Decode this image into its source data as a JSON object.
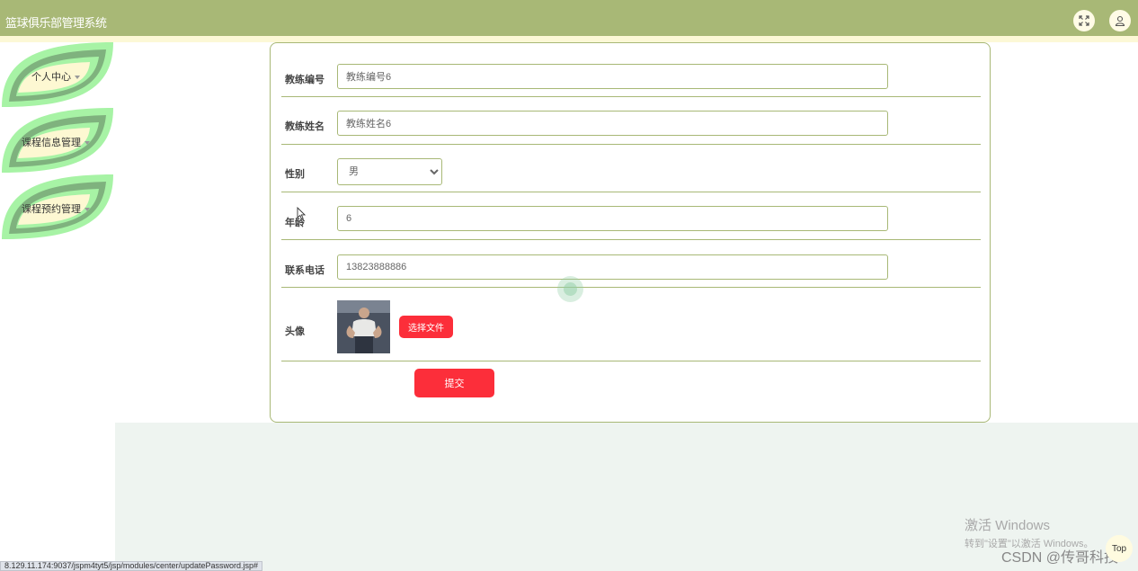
{
  "header": {
    "title": "篮球俱乐部管理系统",
    "fullscreen_icon": "fullscreen-icon",
    "user_icon": "user-icon"
  },
  "sidebar": {
    "items": [
      {
        "label": "个人中心"
      },
      {
        "label": "课程信息管理"
      },
      {
        "label": "课程预约管理"
      }
    ]
  },
  "form": {
    "fields": {
      "coach_id": {
        "label": "教练编号",
        "value": "教练编号6"
      },
      "coach_name": {
        "label": "教练姓名",
        "value": "教练姓名6"
      },
      "gender": {
        "label": "性别",
        "value": "男"
      },
      "age": {
        "label": "年龄",
        "value": "6"
      },
      "phone": {
        "label": "联系电话",
        "value": "13823888886"
      },
      "avatar": {
        "label": "头像",
        "button": "选择文件"
      }
    },
    "submit_label": "提交"
  },
  "statusbar": {
    "url": "8.129.11.174:9037/jspm4tyt5/jsp/modules/center/updatePassword.jsp#"
  },
  "watermarks": {
    "windows_line1": "激活 Windows",
    "windows_line2": "转到\"设置\"以激活 Windows。",
    "csdn": "CSDN @传哥科技"
  },
  "float_button": "Top",
  "colors": {
    "header": "#a8b876",
    "accent_red": "#fc2e3a",
    "leaf_green": "#a7f3a5",
    "content_bg": "#eef4f0"
  }
}
